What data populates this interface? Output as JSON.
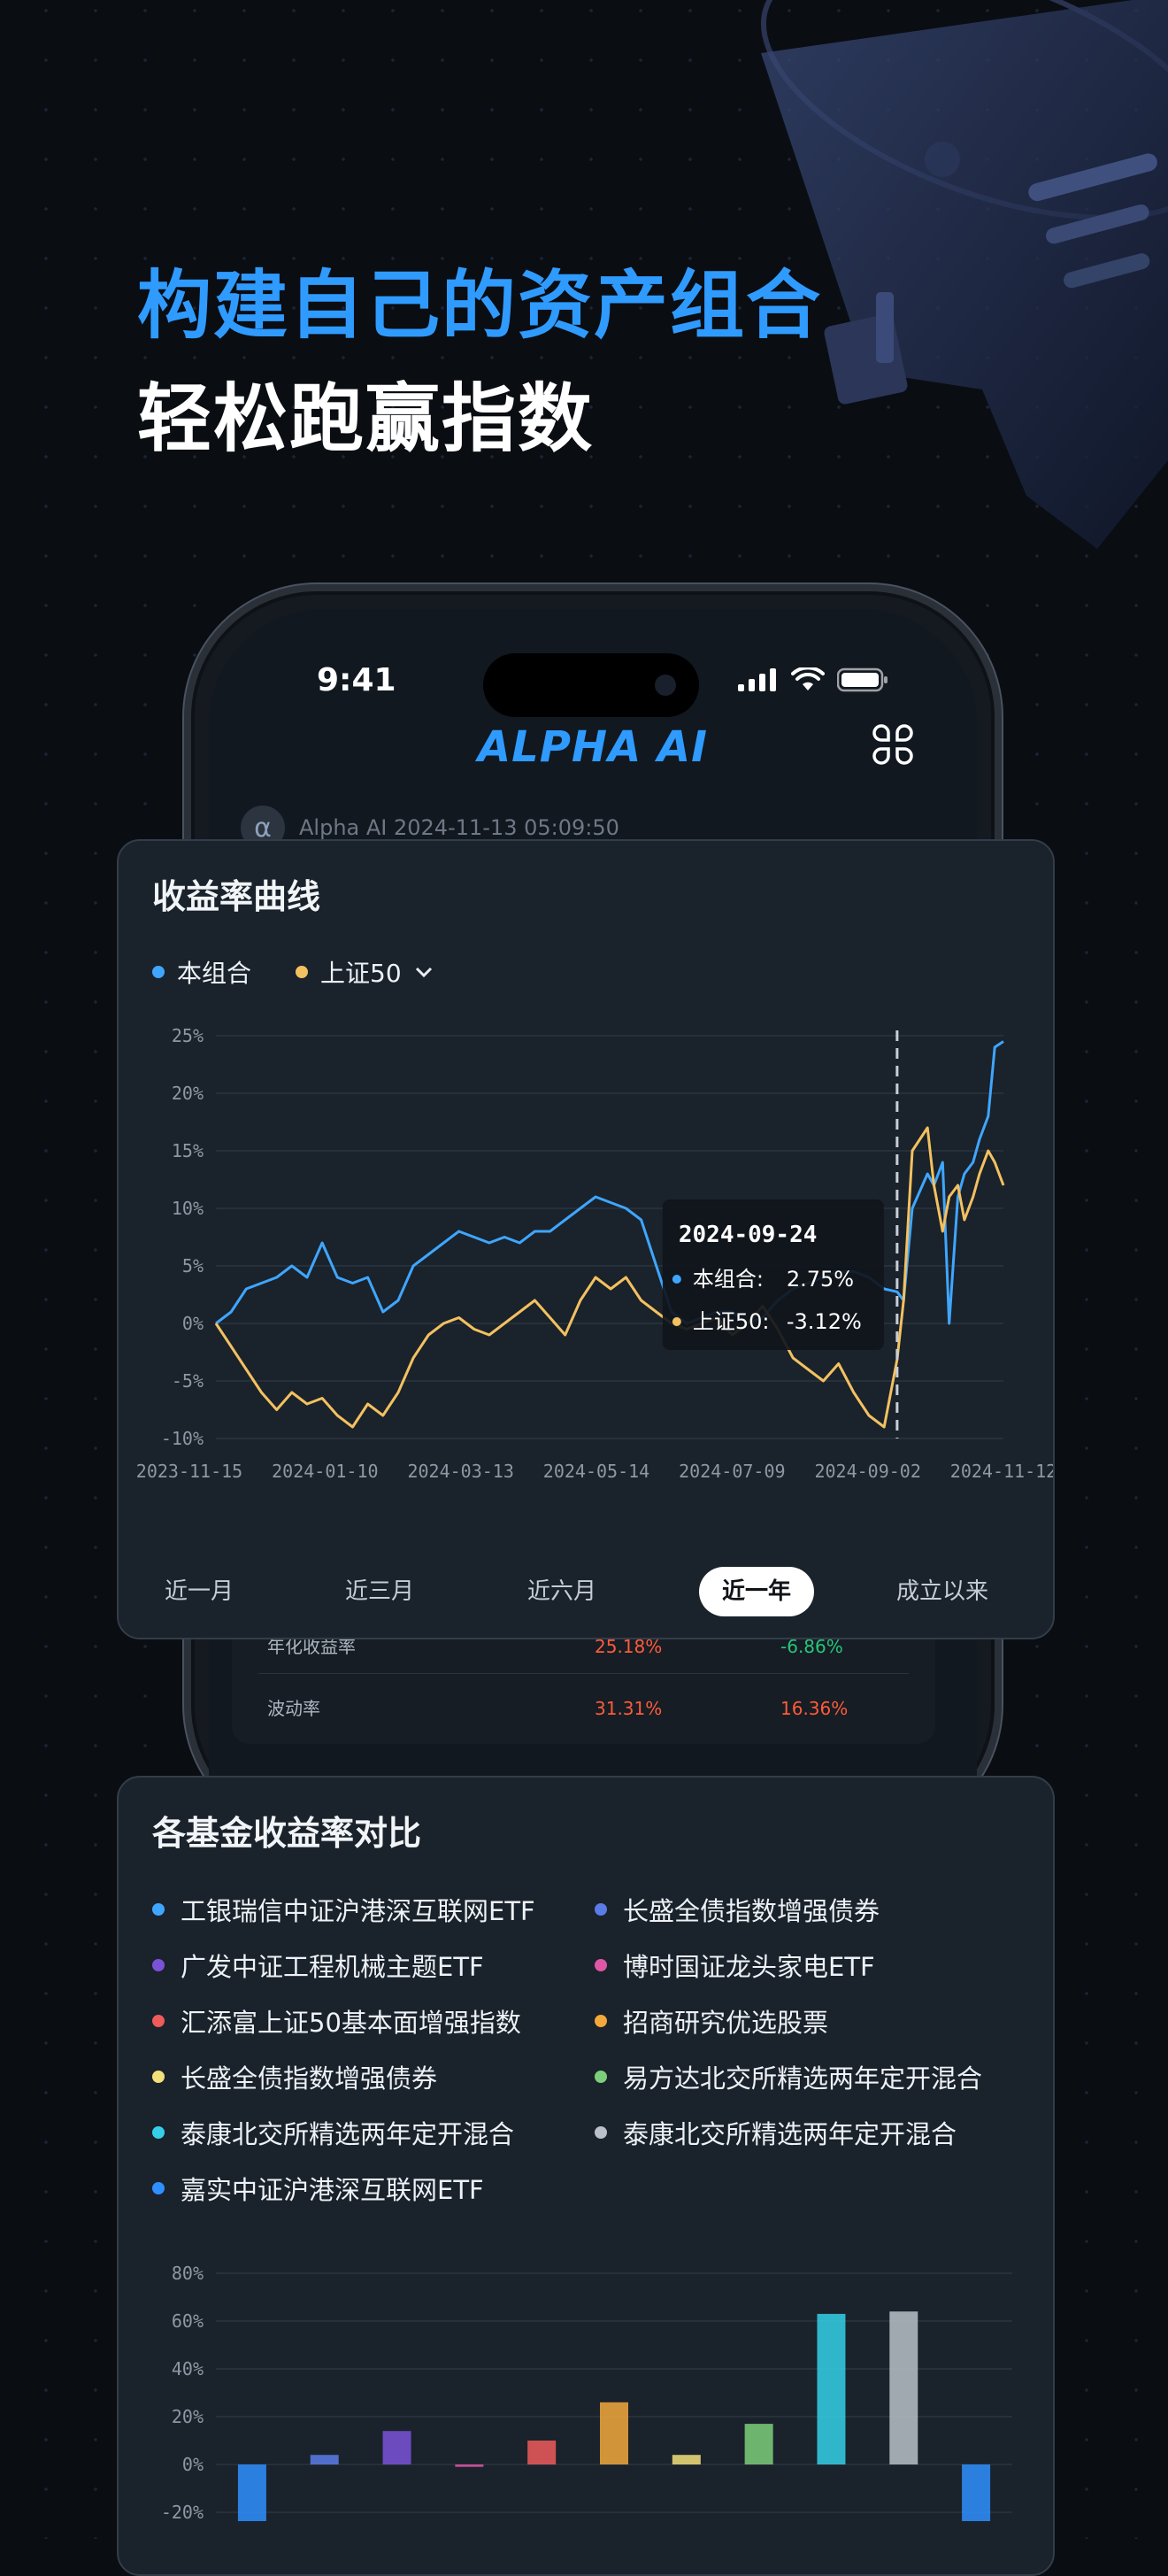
{
  "headline": {
    "line1": "构建自己的资产组合",
    "line2": "轻松跑赢指数"
  },
  "phone": {
    "status_time": "9:41",
    "app_title": "ALPHA AI",
    "message_avatar": "α",
    "message_meta": "Alpha AI 2024-11-13 05:09:50"
  },
  "return_chart": {
    "title": "收益率曲线",
    "legend": [
      {
        "label": "本组合",
        "color": "#3fa6ff"
      },
      {
        "label": "上证50",
        "color": "#f3c160"
      }
    ],
    "dropdown_icon": "chevron-down-icon",
    "tooltip": {
      "date": "2024-09-24",
      "rows": [
        {
          "label": "本组合:",
          "value": "2.75%",
          "color": "#3fa6ff"
        },
        {
          "label": "上证50:",
          "value": "-3.12%",
          "color": "#f3c160"
        }
      ]
    },
    "tabs": [
      {
        "label": "近一月",
        "active": false
      },
      {
        "label": "近三月",
        "active": false
      },
      {
        "label": "近六月",
        "active": false
      },
      {
        "label": "近一年",
        "active": true
      },
      {
        "label": "成立以来",
        "active": false
      }
    ]
  },
  "metrics": [
    {
      "label": "年化收益率",
      "portfolio": "25.18%",
      "index": "-6.86%",
      "portfolio_color": "#ff5b3a",
      "index_color": "#27c57a"
    },
    {
      "label": "波动率",
      "portfolio": "31.31%",
      "index": "16.36%",
      "portfolio_color": "#ff5b3a",
      "index_color": "#ff5b3a"
    }
  ],
  "fund_compare": {
    "title": "各基金收益率对比",
    "funds": [
      {
        "label": "工银瑞信中证沪港深互联网ETF",
        "color": "#3fa6ff"
      },
      {
        "label": "长盛全债指数增强债券",
        "color": "#5b7be6"
      },
      {
        "label": "广发中证工程机械主题ETF",
        "color": "#7a52d8"
      },
      {
        "label": "博时国证龙头家电ETF",
        "color": "#e056a6"
      },
      {
        "label": "汇添富上证50基本面增强指数",
        "color": "#ef5a5a"
      },
      {
        "label": "招商研究优选股票",
        "color": "#f3a83c"
      },
      {
        "label": "长盛全债指数增强债券",
        "color": "#f3e07a"
      },
      {
        "label": "易方达北交所精选两年定开混合",
        "color": "#7ccf7a"
      },
      {
        "label": "泰康北交所精选两年定开混合",
        "color": "#35d0e8"
      },
      {
        "label": "泰康北交所精选两年定开混合",
        "color": "#b9c0c8"
      },
      {
        "label": "嘉实中证沪港深互联网ETF",
        "color": "#2f8fff"
      }
    ]
  },
  "chart_data": [
    {
      "type": "line",
      "title": "收益率曲线",
      "x_tick_labels": [
        "2023-11-15",
        "2024-01-10",
        "2024-03-13",
        "2024-05-14",
        "2024-07-09",
        "2024-09-02",
        "2024-11-12"
      ],
      "y_tick_labels": [
        "25%",
        "20%",
        "15%",
        "10%",
        "5%",
        "0%",
        "-5%",
        "-10%"
      ],
      "ylim": [
        -10,
        25
      ],
      "x_range": [
        "2023-11-15",
        "2024-11-12"
      ],
      "grid": true,
      "marker_date": "2024-09-24",
      "series": [
        {
          "name": "本组合",
          "color": "#3fa6ff",
          "x": [
            "2023-11-15",
            "2023-11-22",
            "2023-11-29",
            "2023-12-06",
            "2023-12-13",
            "2023-12-20",
            "2023-12-27",
            "2024-01-03",
            "2024-01-10",
            "2024-01-17",
            "2024-01-24",
            "2024-01-31",
            "2024-02-07",
            "2024-02-14",
            "2024-02-21",
            "2024-02-28",
            "2024-03-06",
            "2024-03-13",
            "2024-03-20",
            "2024-03-27",
            "2024-04-03",
            "2024-04-10",
            "2024-04-17",
            "2024-04-24",
            "2024-05-01",
            "2024-05-08",
            "2024-05-15",
            "2024-05-22",
            "2024-05-29",
            "2024-06-05",
            "2024-06-12",
            "2024-06-19",
            "2024-06-26",
            "2024-07-03",
            "2024-07-10",
            "2024-07-17",
            "2024-07-24",
            "2024-07-31",
            "2024-08-07",
            "2024-08-14",
            "2024-08-21",
            "2024-08-28",
            "2024-09-04",
            "2024-09-11",
            "2024-09-18",
            "2024-09-24",
            "2024-09-27",
            "2024-10-01",
            "2024-10-08",
            "2024-10-11",
            "2024-10-15",
            "2024-10-18",
            "2024-10-22",
            "2024-10-25",
            "2024-10-29",
            "2024-11-01",
            "2024-11-05",
            "2024-11-08",
            "2024-11-12"
          ],
          "y": [
            0,
            1,
            3,
            3.5,
            4,
            5,
            4,
            7,
            4,
            3.5,
            4,
            1,
            2,
            5,
            6,
            7,
            8,
            7.5,
            7,
            7.5,
            7,
            8,
            8,
            9,
            10,
            11,
            10.5,
            10,
            9,
            5,
            1,
            0,
            0.5,
            1,
            1,
            0,
            0.5,
            2,
            3,
            3.5,
            4,
            4.5,
            4.5,
            4,
            3,
            2.75,
            2,
            10,
            13,
            12,
            14,
            0,
            11,
            13,
            14,
            16,
            18,
            24,
            24.5
          ]
        },
        {
          "name": "上证50",
          "color": "#f3c160",
          "x": [
            "2023-11-15",
            "2023-11-22",
            "2023-11-29",
            "2023-12-06",
            "2023-12-13",
            "2023-12-20",
            "2023-12-27",
            "2024-01-03",
            "2024-01-10",
            "2024-01-17",
            "2024-01-24",
            "2024-01-31",
            "2024-02-07",
            "2024-02-14",
            "2024-02-21",
            "2024-02-28",
            "2024-03-06",
            "2024-03-13",
            "2024-03-20",
            "2024-03-27",
            "2024-04-03",
            "2024-04-10",
            "2024-04-17",
            "2024-04-24",
            "2024-05-01",
            "2024-05-08",
            "2024-05-15",
            "2024-05-22",
            "2024-05-29",
            "2024-06-05",
            "2024-06-12",
            "2024-06-19",
            "2024-06-26",
            "2024-07-03",
            "2024-07-10",
            "2024-07-17",
            "2024-07-24",
            "2024-07-31",
            "2024-08-07",
            "2024-08-14",
            "2024-08-21",
            "2024-08-28",
            "2024-09-04",
            "2024-09-11",
            "2024-09-18",
            "2024-09-24",
            "2024-09-27",
            "2024-10-01",
            "2024-10-08",
            "2024-10-11",
            "2024-10-15",
            "2024-10-18",
            "2024-10-22",
            "2024-10-25",
            "2024-10-29",
            "2024-11-01",
            "2024-11-05",
            "2024-11-08",
            "2024-11-12"
          ],
          "y": [
            0,
            -2,
            -4,
            -6,
            -7.5,
            -6,
            -7,
            -6.5,
            -8,
            -9,
            -7,
            -8,
            -6,
            -3,
            -1,
            0,
            0.5,
            -0.5,
            -1,
            0,
            1,
            2,
            0.5,
            -1,
            2,
            4,
            3,
            4,
            2,
            1,
            0,
            -0.5,
            0,
            0.5,
            -1,
            0,
            1.5,
            -0.5,
            -3,
            -4,
            -5,
            -3.5,
            -6,
            -8,
            -9,
            -3.12,
            2,
            15,
            17,
            12,
            8,
            11,
            12,
            9,
            11,
            13,
            15,
            14,
            12
          ]
        }
      ]
    },
    {
      "type": "bar",
      "title": "各基金收益率对比",
      "y_tick_labels": [
        "80%",
        "60%",
        "40%",
        "20%",
        "0%",
        "-20%"
      ],
      "ylim": [
        -20,
        80
      ],
      "grid": true,
      "categories": [
        "工银瑞信中证沪港深互联网ETF",
        "长盛全债指数增强债券",
        "广发中证工程机械主题ETF",
        "博时国证龙头家电ETF",
        "汇添富上证50基本面增强指数",
        "招商研究优选股票",
        "长盛全债指数增强债券",
        "易方达北交所精选两年定开混合",
        "泰康北交所精选两年定开混合",
        "泰康北交所精选两年定开混合",
        "嘉实中证沪港深互联网ETF"
      ],
      "values": [
        -25,
        4,
        14,
        -1,
        10,
        26,
        4,
        17,
        63,
        64,
        -25
      ],
      "colors": [
        "#2f8fff",
        "#5b7be6",
        "#7a52d8",
        "#e056a6",
        "#ef5a5a",
        "#f3a83c",
        "#f3e07a",
        "#7ccf7a",
        "#35d0e8",
        "#b9c0c8",
        "#2f8fff"
      ]
    }
  ]
}
